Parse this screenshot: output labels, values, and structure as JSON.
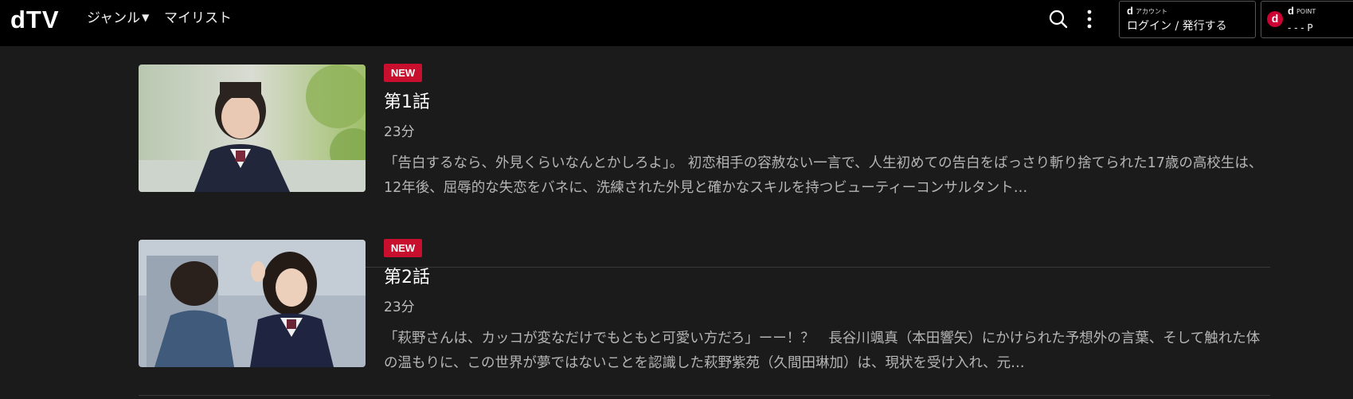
{
  "header": {
    "logo": "dTV",
    "nav": {
      "genre_label": "ジャンル",
      "mylist_label": "マイリスト"
    },
    "account": {
      "small_label": "アカウント",
      "d_mark": "d",
      "login_label": "ログイン / 発行する"
    },
    "dpoint": {
      "d_mark": "d",
      "small_label": "POINT",
      "value": "- - - P"
    },
    "icons": [
      "search-icon",
      "more-vertical-icon",
      "caret-down-icon"
    ]
  },
  "episodes": [
    {
      "badge": "NEW",
      "title": "第1話",
      "duration": "23分",
      "description": "「告白するなら、外見くらいなんとかしろよ」。 初恋相手の容赦ない一言で、人生初めての告白をばっさり斬り捨てられた17歳の高校生は、12年後、屈辱的な失恋をバネに、洗練された外見と確かなスキルを持つビューティーコンサルタント…"
    },
    {
      "badge": "NEW",
      "title": "第2話",
      "duration": "23分",
      "description": "「萩野さんは、カッコが変なだけでもともと可愛い方だろ」ーー！？　長谷川颯真（本田響矢）にかけられた予想外の言葉、そして触れた体の温もりに、この世界が夢ではないことを認識した萩野紫苑（久間田琳加）は、現状を受け入れ、元…"
    }
  ],
  "colors": {
    "background": "#1b1b1b",
    "header": "#000000",
    "badge": "#c8102e",
    "dpoint": "#cc0033"
  }
}
